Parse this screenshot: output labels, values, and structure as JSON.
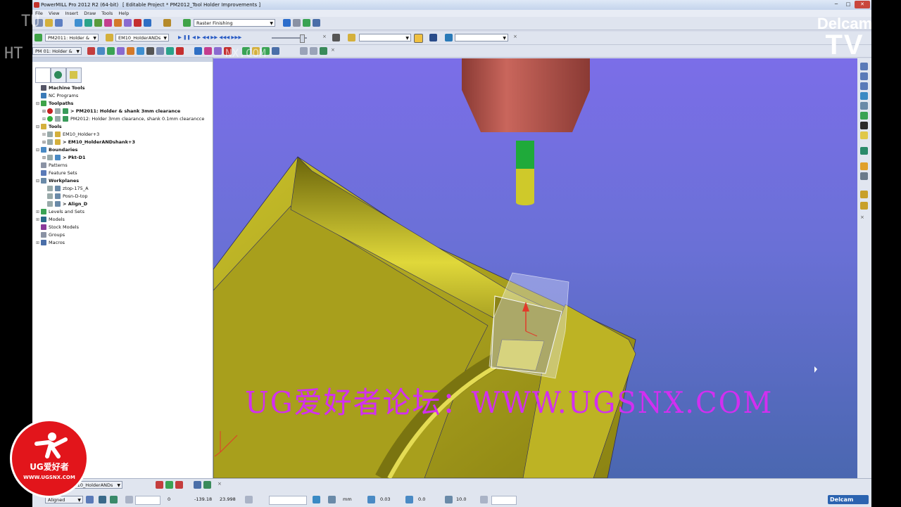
{
  "window": {
    "app_title": "PowerMILL Pro 2012 R2 (64-bit)",
    "project_title": "[ Editable Project * PM2012_Tool Holder Improvements ]"
  },
  "menu": [
    "File",
    "View",
    "Insert",
    "Draw",
    "Tools",
    "Help"
  ],
  "toolbar1": {
    "strategy_combo": "Raster Finishing"
  },
  "toolbar2": {
    "toolpath_combo": "PM2011: Holder &",
    "tool_combo": "EM10_HolderANDs"
  },
  "toolbar3": {
    "toolpath_combo": "PM 01: Holder &"
  },
  "tree": [
    {
      "label": "Machine Tools",
      "bold": true
    },
    {
      "label": "NC Programs",
      "bold": false
    },
    {
      "label": "Toolpaths",
      "bold": true
    },
    {
      "label": "> PM2011: Holder & shank 3mm clearance",
      "bold": true
    },
    {
      "label": "PM2012: Holder 3mm clearance, shank 0.1mm clearancce",
      "bold": false
    },
    {
      "label": "Tools",
      "bold": true
    },
    {
      "label": "EM10_Holder+3",
      "bold": false
    },
    {
      "label": "> EM10_HolderANDshank+3",
      "bold": true
    },
    {
      "label": "Boundaries",
      "bold": true
    },
    {
      "label": "> Pkt-D1",
      "bold": true
    },
    {
      "label": "Patterns",
      "bold": false
    },
    {
      "label": "Feature Sets",
      "bold": false
    },
    {
      "label": "Workplanes",
      "bold": true
    },
    {
      "label": "ztop-175_A",
      "bold": false
    },
    {
      "label": "Posn-D-top",
      "bold": false
    },
    {
      "label": "> Align_D",
      "bold": true
    },
    {
      "label": "Levels and Sets",
      "bold": false
    },
    {
      "label": "Models",
      "bold": false
    },
    {
      "label": "Stock Models",
      "bold": false
    },
    {
      "label": "Groups",
      "bold": false
    },
    {
      "label": "Macros",
      "bold": false
    }
  ],
  "statusbar": {
    "tool_combo": "EM10_HolderANDs",
    "workplane_combo": "Aligned",
    "coord_x": "0",
    "coord_y": "-139.18",
    "coord_z": "23.998",
    "units": "mm",
    "tolerance": "0.03",
    "thickness": "0.0",
    "stepover": "10.0",
    "brand": "Delcam"
  },
  "overlays": {
    "delcam_tv_top": "Delcam",
    "delcam_tv_bottom": "TV",
    "watermark_top1": "TU",
    "watermark_top2": "HT",
    "watermark_top3": "NX.COM",
    "watermark_main": "UG爱好者论坛：WWW.UGSNX.COM",
    "badge_name": "UG爱好者",
    "badge_url": "WWW.UGSNX.COM"
  },
  "colors": {
    "viewport_top": "#7b6ee8",
    "viewport_bottom": "#4a67b0",
    "part_yellow": "#b0a81a",
    "holder_red": "#b5544c",
    "shank_green": "#1faa3a",
    "tool_yellow": "#cfc92a",
    "watermark_purple": "#d22ff0"
  }
}
